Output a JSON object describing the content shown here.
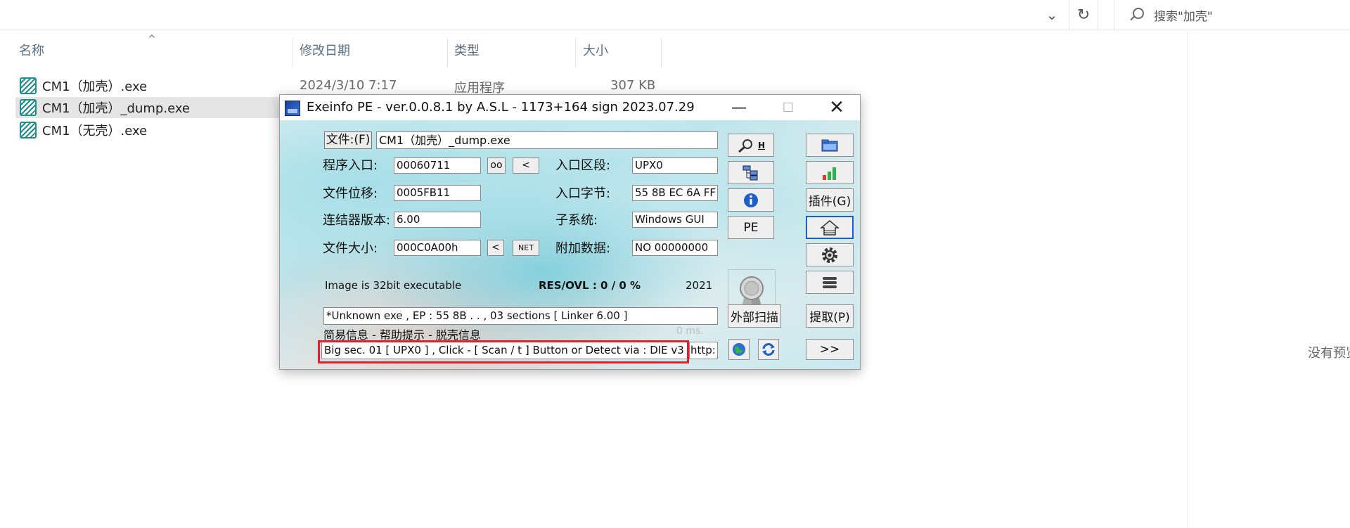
{
  "explorer": {
    "search_placeholder": "搜索\"加壳\"",
    "columns": {
      "name": "名称",
      "date": "修改日期",
      "type": "类型",
      "size": "大小"
    },
    "files": [
      {
        "name": "CM1（加壳）.exe",
        "date": "2024/3/10 7:17",
        "type": "应用程序",
        "size": "307 KB"
      },
      {
        "name": "CM1（加壳）_dump.exe",
        "date": "",
        "type": "",
        "size": ""
      },
      {
        "name": "CM1（无壳）.exe",
        "date": "",
        "type": "",
        "size": ""
      }
    ],
    "no_preview": "没有预览"
  },
  "exeinfo": {
    "title": "Exeinfo PE - ver.0.0.8.1  by A.S.L -  1173+164 sign  2023.07.29",
    "file_button": "文件:(F)",
    "file_path": "CM1（加壳）_dump.exe",
    "labels": {
      "entry_point": "程序入口:",
      "file_offset": "文件位移:",
      "linker_version": "连结器版本:",
      "file_size": "文件大小:",
      "entry_section": "入口区段:",
      "entry_bytes": "入口字节:",
      "subsystem": "子系统:",
      "overlay": "附加数据:"
    },
    "values": {
      "entry_point": "00060711",
      "file_offset": "0005FB11",
      "linker_version": "6.00",
      "file_size": "000C0A00h",
      "entry_section": "UPX0",
      "entry_bytes": "55 8B EC 6A FF",
      "subsystem": "Windows GUI",
      "overlay": "NO   00000000"
    },
    "buttons": {
      "oo": "oo",
      "lt1": "<",
      "lt2": "<",
      "net": "NET",
      "pe": "PE",
      "plugin": "插件(G)",
      "external_scan": "外部扫描",
      "extract": "提取(P)",
      "next": ">>",
      "search_h": "H"
    },
    "info": {
      "image_type": "Image is 32bit executable",
      "res_ovl": "RES/OVL : 0 / 0 %",
      "year": "2021",
      "scan_result": "*Unknown exe , EP : 55 8B . . , 03 sections  [ Linker 6.00 ]",
      "hint_label": "简易信息 - 帮助提示 - 脱壳信息",
      "ms": "0 ms.",
      "lamer_info": "Big sec. 01 [ UPX0 ] , Click - [ Scan / t ]  Button  or Detect via : DIE v3",
      "http": "http:"
    },
    "colors": {
      "highlight": "#e0202a",
      "marble": "#bfe6ec"
    }
  }
}
